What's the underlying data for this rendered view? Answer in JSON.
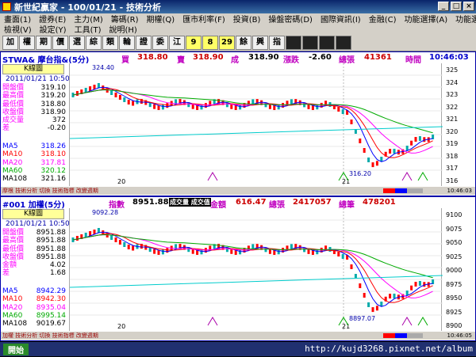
{
  "window": {
    "title": "新世紀贏家 - 100/01/21 - 技術分析"
  },
  "menu": {
    "row1": [
      "畫面(1)",
      "證券(E)",
      "主力(M)",
      "籌碼(R)",
      "期權(Q)",
      "匯市利率(F)",
      "投資(B)",
      "操盤密碼(D)",
      "國際資訊(I)",
      "金融(C)",
      "功能選擇(A)",
      "功能選擇(S)"
    ],
    "row2": [
      "檢視(V)",
      "設定(Y)",
      "工具(T)",
      "說明(H)"
    ]
  },
  "toolbar": [
    "加",
    "權",
    "期",
    "價",
    "選",
    "綜",
    "類",
    "輪",
    "證",
    "委",
    "江",
    "9",
    "8",
    "29",
    "餘",
    "興",
    "指",
    "",
    "",
    "",
    ""
  ],
  "panel1": {
    "header": {
      "name": "STWA& 摩台指&(5分)",
      "buy_label": "買",
      "buy": "318.80",
      "sell_label": "賣",
      "sell": "318.90",
      "deal_label": "成",
      "deal": "318.90",
      "change_label": "漲跌",
      "change": "-2.60",
      "vol_label": "總張",
      "vol": "41361",
      "time_label": "時間",
      "time": "10:46:03"
    },
    "kbox": "K線圖",
    "date": "2011/01/21 10:50",
    "info": [
      [
        "開盤價",
        "319.10"
      ],
      [
        "最高價",
        "319.20"
      ],
      [
        "最低價",
        "318.80"
      ],
      [
        "收盤價",
        "318.90"
      ],
      [
        "成交量",
        "372"
      ],
      [
        "差",
        "-0.20"
      ]
    ],
    "ma": [
      [
        "MA5",
        "318.26"
      ],
      [
        "MA10",
        "318.10"
      ],
      [
        "MA20",
        "317.81"
      ],
      [
        "MA60",
        "320.12"
      ],
      [
        "MA108",
        "321.16"
      ]
    ],
    "yticks": [
      "325",
      "324",
      "323",
      "322",
      "321",
      "320",
      "319",
      "318",
      "317",
      "316"
    ],
    "xlabels": [
      "20",
      "21"
    ],
    "high_label": "324.40",
    "low_label": "316.20",
    "status": "摩根 技術分析  切換 技術指標  改變週期",
    "clock": "10:46:03"
  },
  "panel2": {
    "header": {
      "name": "#001 加權(5分)",
      "idx_label": "指數",
      "idx": "8951.88",
      "tag": "成交量 成交值",
      "amt_label": "金額",
      "amt": "616.47",
      "vol_label": "總張",
      "vol": "2417057",
      "cnt_label": "總筆",
      "cnt": "478201"
    },
    "kbox": "K線圖",
    "date": "2011/01/21 10:50",
    "info": [
      [
        "開盤價",
        "8951.88"
      ],
      [
        "最高價",
        "8951.88"
      ],
      [
        "最低價",
        "8951.88"
      ],
      [
        "收盤價",
        "8951.88"
      ],
      [
        "金額",
        "4.02"
      ],
      [
        "差",
        "1.68"
      ]
    ],
    "ma": [
      [
        "MA5",
        "8942.29"
      ],
      [
        "MA10",
        "8942.30"
      ],
      [
        "MA20",
        "8935.04"
      ],
      [
        "MA60",
        "8995.14"
      ],
      [
        "MA108",
        "9019.67"
      ]
    ],
    "yticks": [
      "9100",
      "9075",
      "9050",
      "9025",
      "9000",
      "8975",
      "8950",
      "8925",
      "8900"
    ],
    "xlabels": [
      "20",
      "21"
    ],
    "high_label": "9092.28",
    "low_label": "8897.07",
    "status": "加權 技術分析  切換 技術指標  改變週期",
    "clock": "10:46:05"
  },
  "taskbar": {
    "start": "開始",
    "url": "http://kujd3268.pixnet.net/album"
  }
}
